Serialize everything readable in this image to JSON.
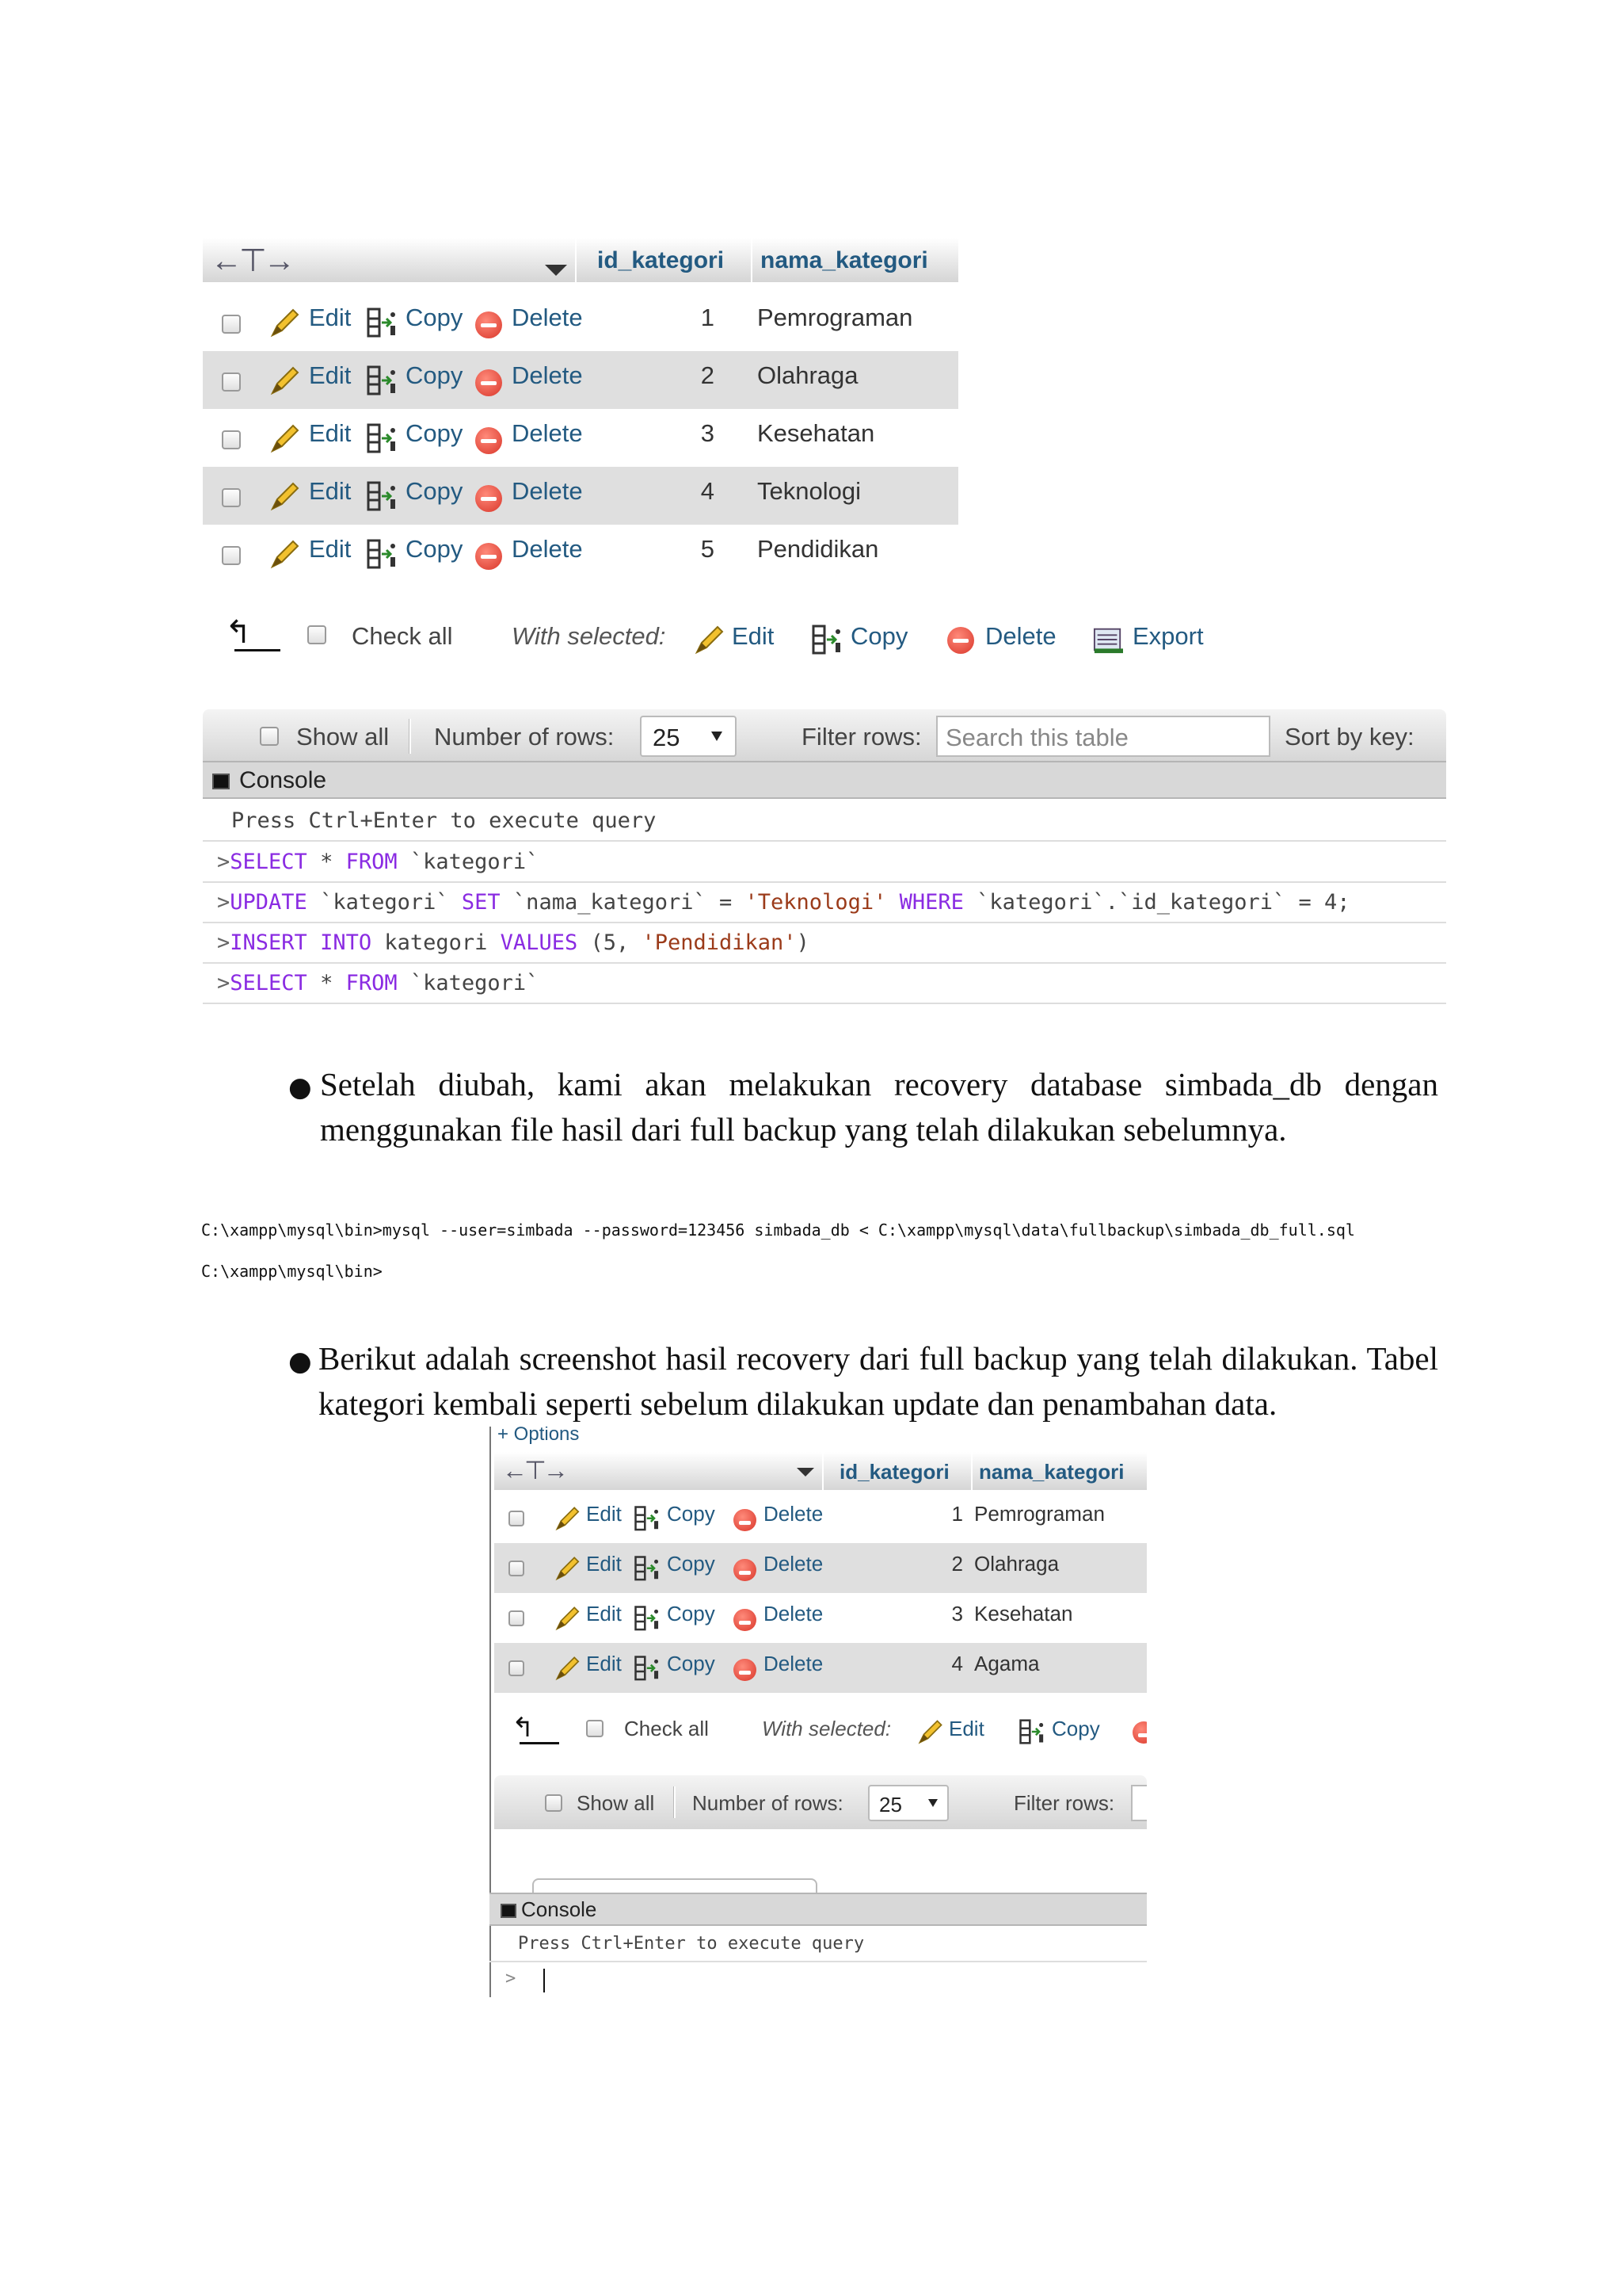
{
  "table_headers": {
    "id": "id_kategori",
    "nama": "nama_kategori"
  },
  "row_actions": {
    "edit": "Edit",
    "copy": "Copy",
    "delete": "Delete"
  },
  "table1": {
    "rows": [
      {
        "id": "1",
        "nama": "Pemrograman"
      },
      {
        "id": "2",
        "nama": "Olahraga"
      },
      {
        "id": "3",
        "nama": "Kesehatan"
      },
      {
        "id": "4",
        "nama": "Teknologi"
      },
      {
        "id": "5",
        "nama": "Pendidikan"
      }
    ]
  },
  "bulk": {
    "check_all": "Check all",
    "with_selected": "With selected:",
    "edit": "Edit",
    "copy": "Copy",
    "delete": "Delete",
    "export": "Export"
  },
  "nav": {
    "show_all": "Show all",
    "number_of_rows": "Number of rows:",
    "rows_value": "25",
    "filter_rows": "Filter rows:",
    "search_placeholder": "Search this table",
    "sort_by_key": "Sort by key:"
  },
  "console": {
    "title": "Console",
    "hint": "Press Ctrl+Enter to execute query",
    "queries": [
      "SELECT * FROM `kategori`",
      "UPDATE `kategori` SET `nama_kategori` = 'Teknologi' WHERE `kategori`.`id_kategori` = 4;",
      "INSERT INTO kategori VALUES (5, 'Pendidikan')",
      "SELECT * FROM `kategori`"
    ]
  },
  "paragraph1": "Setelah diubah, kami akan melakukan recovery database simbada_db dengan menggunakan file hasil dari full backup yang telah dilakukan sebelumnya.",
  "terminal": {
    "line1": "C:\\xampp\\mysql\\bin>mysql --user=simbada --password=123456 simbada_db < C:\\xampp\\mysql\\data\\fullbackup\\simbada_db_full.sql",
    "line2": "C:\\xampp\\mysql\\bin>"
  },
  "paragraph2": "Berikut adalah screenshot hasil recovery dari full backup yang telah dilakukan. Tabel kategori kembali seperti sebelum dilakukan update dan penambahan data.",
  "table2": {
    "options_label": "+ Options",
    "rows": [
      {
        "id": "1",
        "nama": "Pemrograman"
      },
      {
        "id": "2",
        "nama": "Olahraga"
      },
      {
        "id": "3",
        "nama": "Kesehatan"
      },
      {
        "id": "4",
        "nama": "Agama"
      }
    ],
    "console_prompt": ">"
  }
}
